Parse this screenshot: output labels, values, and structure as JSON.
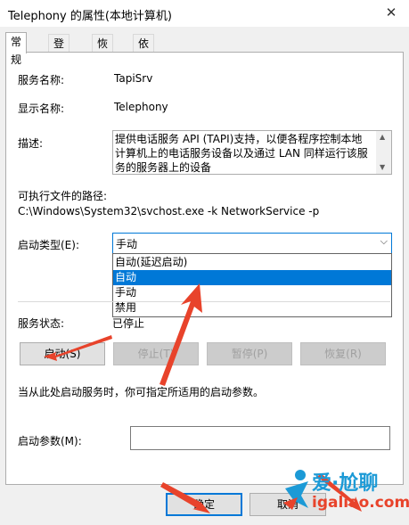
{
  "window": {
    "title": "Telephony 的属性(本地计算机)",
    "close_icon": "close-icon"
  },
  "tabs": [
    {
      "label": "常规"
    },
    {
      "label": "登录"
    },
    {
      "label": "恢复"
    },
    {
      "label": "依存关系"
    }
  ],
  "general": {
    "service_name_label": "服务名称:",
    "service_name_value": "TapiSrv",
    "display_name_label": "显示名称:",
    "display_name_value": "Telephony",
    "description_label": "描述:",
    "description_value": "提供电话服务 API (TAPI)支持，以便各程序控制本地计算机上的电话服务设备以及通过 LAN 同样运行该服务的服务器上的设备",
    "exe_path_label": "可执行文件的路径:",
    "exe_path_value": "C:\\Windows\\System32\\svchost.exe -k NetworkService -p",
    "startup_type_label": "启动类型(E):",
    "startup_type_value": "手动",
    "startup_options": [
      "自动(延迟启动)",
      "自动",
      "手动",
      "禁用"
    ],
    "startup_highlighted_option": "自动",
    "service_status_label": "服务状态:",
    "service_status_value": "已停止",
    "buttons": {
      "start": "启动(S)",
      "stop": "停止(T)",
      "pause": "暂停(P)",
      "resume": "恢复(R)"
    },
    "hint_text": "当从此处启动服务时，你可指定所适用的启动参数。",
    "start_params_label": "启动参数(M):",
    "start_params_value": ""
  },
  "footer": {
    "ok": "确定",
    "cancel": "取消"
  },
  "watermark": {
    "cn": "爱·尬聊",
    "en": "igaliao.com"
  },
  "colors": {
    "accent": "#0078d7",
    "arrow": "#e8432b"
  }
}
